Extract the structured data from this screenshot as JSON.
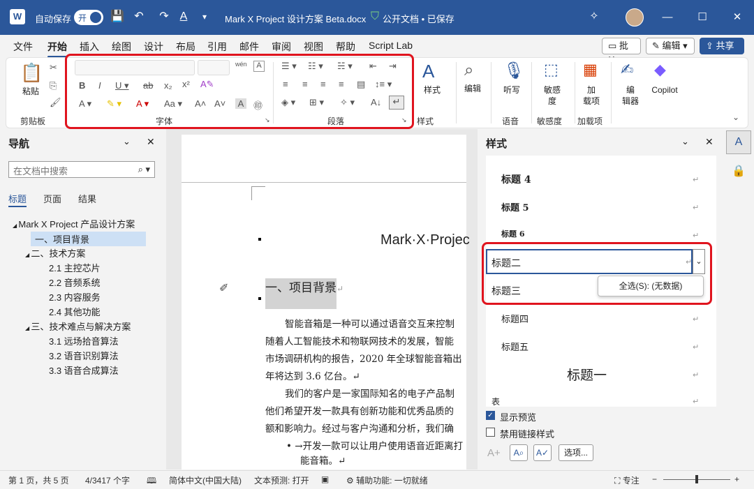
{
  "titlebar": {
    "autosave": "自动保存",
    "toggle": "开",
    "doc_title": "Mark X Project 设计方案 Beta.docx",
    "status": "公开文档 • 已保存"
  },
  "menu": [
    "文件",
    "开始",
    "插入",
    "绘图",
    "设计",
    "布局",
    "引用",
    "邮件",
    "审阅",
    "视图",
    "帮助",
    "Script Lab"
  ],
  "menu_right": {
    "comment": "批注",
    "edit": "编辑",
    "share": "共享"
  },
  "ribbon": {
    "paste": "粘贴",
    "clipboard": "剪贴板",
    "font": "字体",
    "paragraph": "段落",
    "styles": "样式",
    "edit": "编辑",
    "dictate": "听写",
    "voice": "语音",
    "sensitivity": "敏感\n度",
    "sensitivity_group": "敏感度",
    "addins": "加\n载项",
    "addins_group": "加载项",
    "editor": "编\n辑器",
    "copilot": "Copilot"
  },
  "nav": {
    "title": "导航",
    "search_placeholder": "在文档中搜索",
    "tabs": [
      "标题",
      "页面",
      "结果"
    ],
    "tree": [
      {
        "label": "Mark X Project 产品设计方案",
        "level": 0,
        "arrow": "◢"
      },
      {
        "label": "一、项目背景",
        "level": 1,
        "selected": true
      },
      {
        "label": "二、技术方案",
        "level": 1,
        "arrow": "◢"
      },
      {
        "label": "2.1 主控芯片",
        "level": 2
      },
      {
        "label": "2.2 音频系统",
        "level": 2
      },
      {
        "label": "2.3 内容服务",
        "level": 2
      },
      {
        "label": "2.4 其他功能",
        "level": 2
      },
      {
        "label": "三、技术难点与解决方案",
        "level": 1,
        "arrow": "◢"
      },
      {
        "label": "3.1 远场拾音算法",
        "level": 2
      },
      {
        "label": "3.2 语音识别算法",
        "level": 2
      },
      {
        "label": "3.3 语音合成算法",
        "level": 2
      }
    ]
  },
  "doc": {
    "title": "Mark·X·Projec",
    "heading": "一、项目背景",
    "lines": [
      "智能音箱是一种可以通过语音交互来控制",
      "随着人工智能技术和物联网技术的发展，智能",
      "市场调研机构的报告，2020 年全球智能音箱出",
      "年将达到 3.6 亿台。↵",
      "我们的客户是一家国际知名的电子产品制",
      "他们希望开发一款具有创新功能和优秀品质的",
      "额和影响力。经过与客户沟通和分析，我们确",
      "• →开发一款可以让用户使用语音近距离打",
      "能音箱。↵"
    ]
  },
  "styles": {
    "title": "样式",
    "items": [
      "标题 4",
      "标题 5",
      "标题 6",
      "标题二",
      "标题三",
      "标题四",
      "标题五",
      "标题一",
      "表"
    ],
    "select_all": "全选(S): (无数据)",
    "show_preview": "显示预览",
    "disable_linked": "禁用链接样式",
    "options": "选项..."
  },
  "status": {
    "page": "第 1 页，共 5 页",
    "words": "4/3417 个字",
    "lang": "简体中文(中国大陆)",
    "predict": "文本预测: 打开",
    "access": "辅助功能: 一切就绪",
    "focus": "专注"
  }
}
